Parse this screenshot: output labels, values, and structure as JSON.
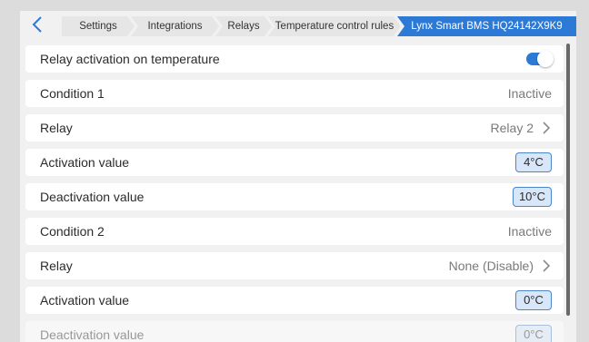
{
  "breadcrumb": {
    "items": [
      {
        "label": "Settings"
      },
      {
        "label": "Integrations"
      },
      {
        "label": "Relays"
      },
      {
        "label": "Temperature control rules"
      },
      {
        "label": "Lynx Smart BMS HQ24142X9K9"
      }
    ]
  },
  "rows": [
    {
      "label": "Relay activation on temperature",
      "toggle_on": true
    },
    {
      "label": "Condition 1",
      "value": "Inactive"
    },
    {
      "label": "Relay",
      "value": "Relay 2"
    },
    {
      "label": "Activation value",
      "value": "4°C"
    },
    {
      "label": "Deactivation value",
      "value": "10°C"
    },
    {
      "label": "Condition 2",
      "value": "Inactive"
    },
    {
      "label": "Relay",
      "value": "None (Disable)"
    },
    {
      "label": "Activation value",
      "value": "0°C"
    },
    {
      "label": "Deactivation value",
      "value": "0°C"
    }
  ],
  "colors": {
    "accent": "#2d7ad6",
    "chip_bg": "#d7e6f9",
    "chip_border": "#4c85c9"
  }
}
